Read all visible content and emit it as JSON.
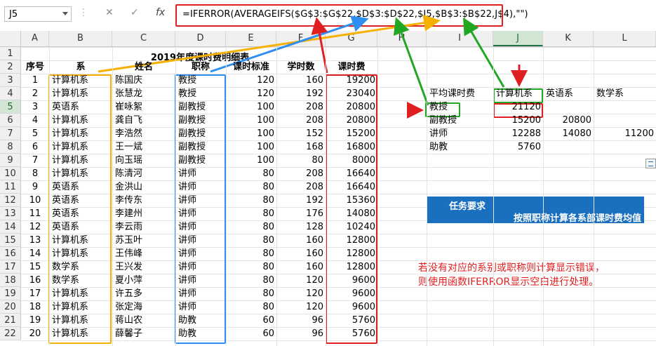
{
  "namebox": "J5",
  "formula": "=IFERROR(AVERAGEIFS($G$3:$G$22,$D$3:$D$22,$I5,$B$3:$B$22,J$4),\"\")",
  "toolbar": {
    "cancel": "✕",
    "confirm": "✓",
    "fx": "fx"
  },
  "columns": [
    "A",
    "B",
    "C",
    "D",
    "E",
    "F",
    "G",
    "H",
    "I",
    "J",
    "K",
    "L"
  ],
  "rows": [
    "1",
    "2",
    "3",
    "4",
    "5",
    "6",
    "7",
    "8",
    "9",
    "10",
    "11",
    "12",
    "13",
    "14",
    "15",
    "16",
    "17",
    "18",
    "19",
    "20",
    "21",
    "22"
  ],
  "title": "2019年度课时费明细表",
  "headers": [
    "序号",
    "系",
    "姓名",
    "职称",
    "课时标准",
    "学时数",
    "课时费"
  ],
  "records": [
    [
      "1",
      "计算机系",
      "陈国庆",
      "教授",
      "120",
      "160",
      "19200"
    ],
    [
      "2",
      "计算机系",
      "张慧龙",
      "教授",
      "120",
      "192",
      "23040"
    ],
    [
      "3",
      "英语系",
      "崔咏絮",
      "副教授",
      "100",
      "208",
      "20800"
    ],
    [
      "4",
      "计算机系",
      "龚自飞",
      "副教授",
      "100",
      "208",
      "20800"
    ],
    [
      "5",
      "计算机系",
      "李浩然",
      "副教授",
      "100",
      "152",
      "15200"
    ],
    [
      "6",
      "计算机系",
      "王一斌",
      "副教授",
      "100",
      "168",
      "16800"
    ],
    [
      "7",
      "计算机系",
      "向玉瑶",
      "副教授",
      "100",
      "80",
      "8000"
    ],
    [
      "8",
      "计算机系",
      "陈清河",
      "讲师",
      "80",
      "208",
      "16640"
    ],
    [
      "9",
      "英语系",
      "金洪山",
      "讲师",
      "80",
      "208",
      "16640"
    ],
    [
      "10",
      "英语系",
      "李传东",
      "讲师",
      "80",
      "192",
      "15360"
    ],
    [
      "11",
      "英语系",
      "李建州",
      "讲师",
      "80",
      "176",
      "14080"
    ],
    [
      "12",
      "英语系",
      "李云雨",
      "讲师",
      "80",
      "128",
      "10240"
    ],
    [
      "13",
      "计算机系",
      "苏玉叶",
      "讲师",
      "80",
      "160",
      "12800"
    ],
    [
      "14",
      "计算机系",
      "王伟峰",
      "讲师",
      "80",
      "160",
      "12800"
    ],
    [
      "15",
      "数学系",
      "王兴发",
      "讲师",
      "80",
      "160",
      "12800"
    ],
    [
      "16",
      "数学系",
      "夏小萍",
      "讲师",
      "80",
      "120",
      "9600"
    ],
    [
      "17",
      "计算机系",
      "许五多",
      "讲师",
      "80",
      "120",
      "9600"
    ],
    [
      "18",
      "计算机系",
      "张定海",
      "讲师",
      "80",
      "120",
      "9600"
    ],
    [
      "19",
      "计算机系",
      "蒋山农",
      "助教",
      "60",
      "96",
      "5760"
    ],
    [
      "20",
      "计算机系",
      "薛馨子",
      "助教",
      "60",
      "96",
      "5760"
    ]
  ],
  "summary": {
    "corner": "平均课时费",
    "depts": [
      "计算机系",
      "英语系",
      "数学系"
    ],
    "rows": [
      {
        "title": "教授",
        "vals": [
          "21120",
          "",
          ""
        ]
      },
      {
        "title": "副教授",
        "vals": [
          "15200",
          "20800",
          ""
        ]
      },
      {
        "title": "讲师",
        "vals": [
          "12288",
          "14080",
          "11200"
        ]
      },
      {
        "title": "助教",
        "vals": [
          "5760",
          "",
          ""
        ]
      }
    ]
  },
  "banner": {
    "label": "任务要求",
    "text": "按照职称计算各系部课时费均值"
  },
  "note": [
    "若没有对应的系别或职称则计算显示错误，",
    "则使用函数IFERROR显示空白进行处理。"
  ],
  "colors": {
    "orange": "#f5b000",
    "blue": "#2e8ff0",
    "red": "#e02020",
    "green": "#22a722",
    "banner": "#1a6fbe"
  }
}
